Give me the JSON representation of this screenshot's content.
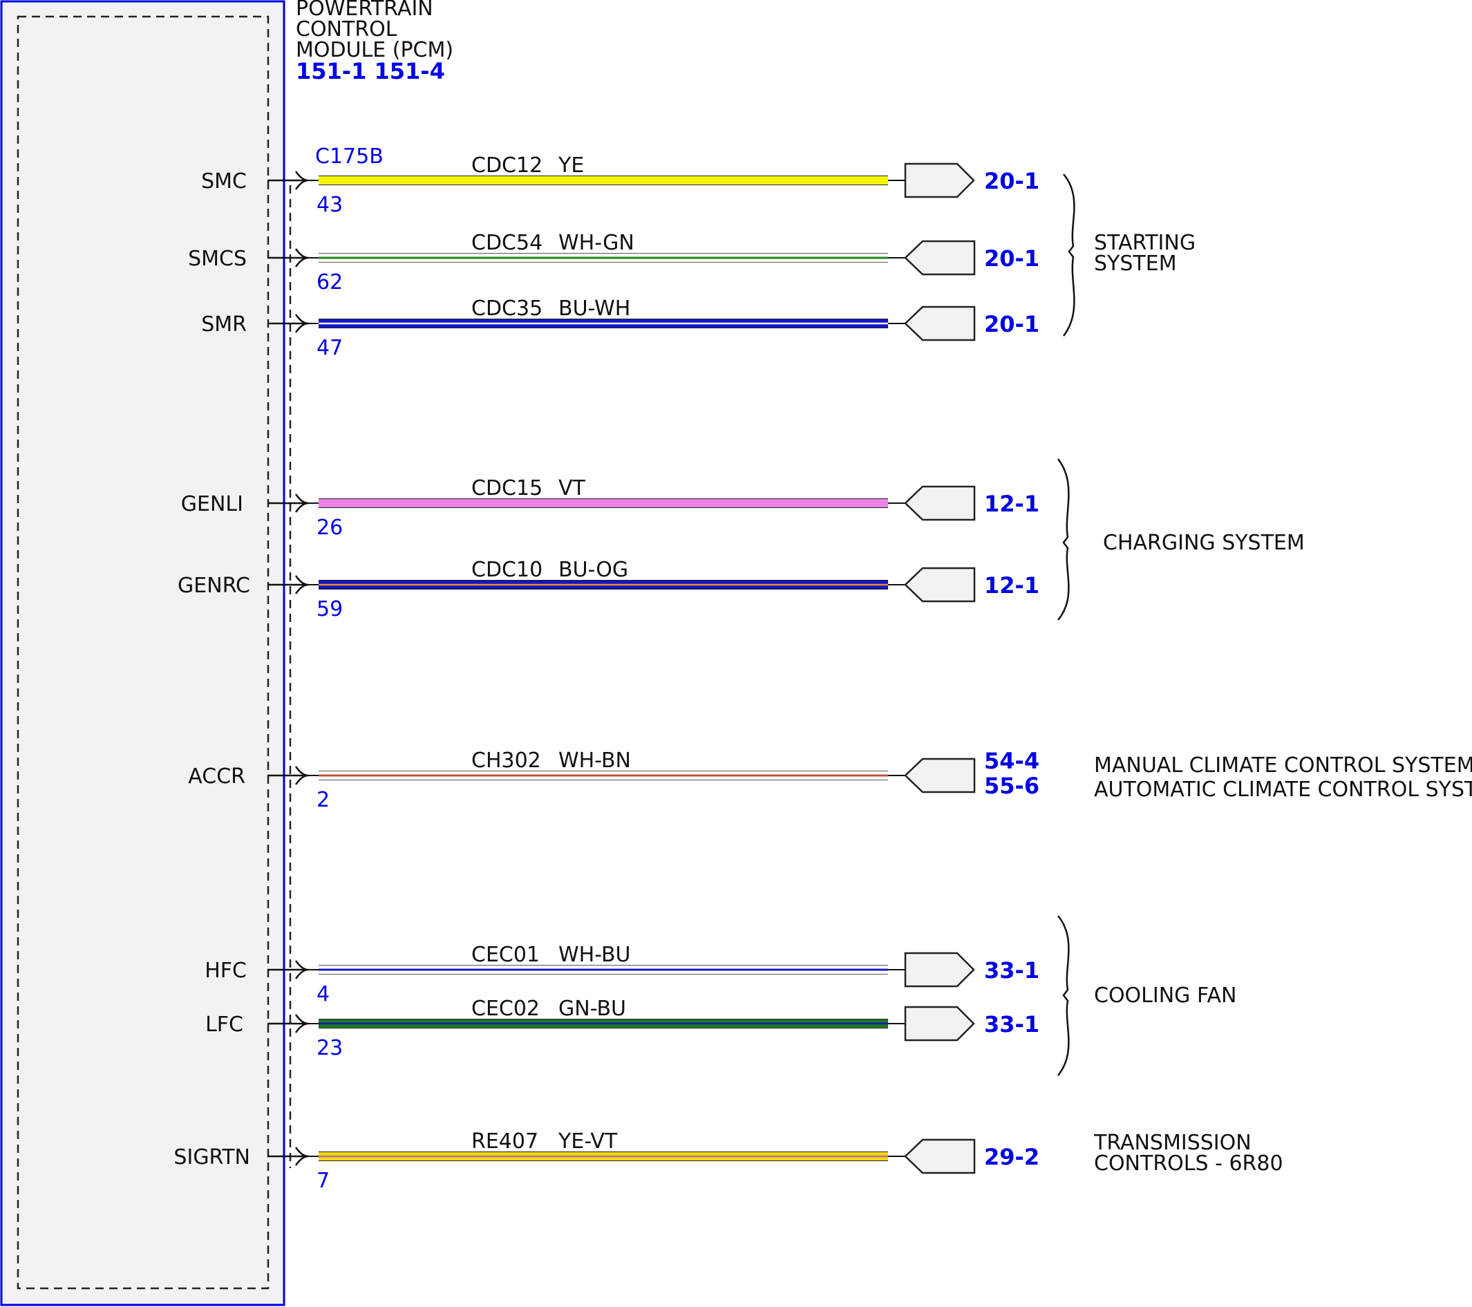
{
  "module": {
    "title_lines": [
      "POWERTRAIN",
      "CONTROL",
      "MODULE (PCM)"
    ],
    "refs": "151-1 151-4",
    "connector": "C175B",
    "fill": "#f2f2f2",
    "frame_color": "#0000e6"
  },
  "circuits": [
    {
      "signal": "SMC",
      "pin": "43",
      "circuit": "CDC12",
      "color_code": "YE",
      "ref": "20-1",
      "ref2": "",
      "base": "#f5f500",
      "stripe": "",
      "thick": true
    },
    {
      "signal": "SMCS",
      "pin": "62",
      "circuit": "CDC54",
      "color_code": "WH-GN",
      "ref": "20-1",
      "ref2": "",
      "base": "#ffffff",
      "stripe": "#1d8a1d",
      "thick": false
    },
    {
      "signal": "SMR",
      "pin": "47",
      "circuit": "CDC35",
      "color_code": "BU-WH",
      "ref": "20-1",
      "ref2": "",
      "base": "#1414c8",
      "stripe": "#ffffff",
      "thick": true
    },
    {
      "signal": "GENLI",
      "pin": "26",
      "circuit": "CDC15",
      "color_code": "VT",
      "ref": "12-1",
      "ref2": "",
      "base": "#ee82e6",
      "stripe": "",
      "thick": true
    },
    {
      "signal": "GENRC",
      "pin": "59",
      "circuit": "CDC10",
      "color_code": "BU-OG",
      "ref": "12-1",
      "ref2": "",
      "base": "#1414c8",
      "stripe": "#f08c28",
      "thick": true
    },
    {
      "signal": "ACCR",
      "pin": "2",
      "circuit": "CH302",
      "color_code": "WH-BN",
      "ref": "54-4",
      "ref2": "55-6",
      "base": "#ffffff",
      "stripe": "#c05040",
      "thick": false
    },
    {
      "signal": "HFC",
      "pin": "4",
      "circuit": "CEC01",
      "color_code": "WH-BU",
      "ref": "33-1",
      "ref2": "",
      "base": "#ffffff",
      "stripe": "#1414c8",
      "thick": false
    },
    {
      "signal": "LFC",
      "pin": "23",
      "circuit": "CEC02",
      "color_code": "GN-BU",
      "ref": "33-1",
      "ref2": "",
      "base": "#1d7a1d",
      "stripe": "#1414c8",
      "thick": true
    },
    {
      "signal": "SIGRTN",
      "pin": "7",
      "circuit": "RE407",
      "color_code": "YE-VT",
      "ref": "29-2",
      "ref2": "",
      "base": "#f5d800",
      "stripe": "#b070b0",
      "thick": true
    }
  ],
  "groups": [
    {
      "lines": [
        "STARTING",
        "SYSTEM"
      ],
      "brace": true
    },
    {
      "lines": [
        "CHARGING SYSTEM"
      ],
      "brace": true
    },
    {
      "lines": [
        "MANUAL CLIMATE CONTROL SYSTEM",
        "AUTOMATIC CLIMATE CONTROL SYSTEM"
      ],
      "brace": false
    },
    {
      "lines": [
        "COOLING FAN"
      ],
      "brace": true
    },
    {
      "lines": [
        "TRANSMISSION",
        "CONTROLS - 6R80"
      ],
      "brace": false
    }
  ]
}
